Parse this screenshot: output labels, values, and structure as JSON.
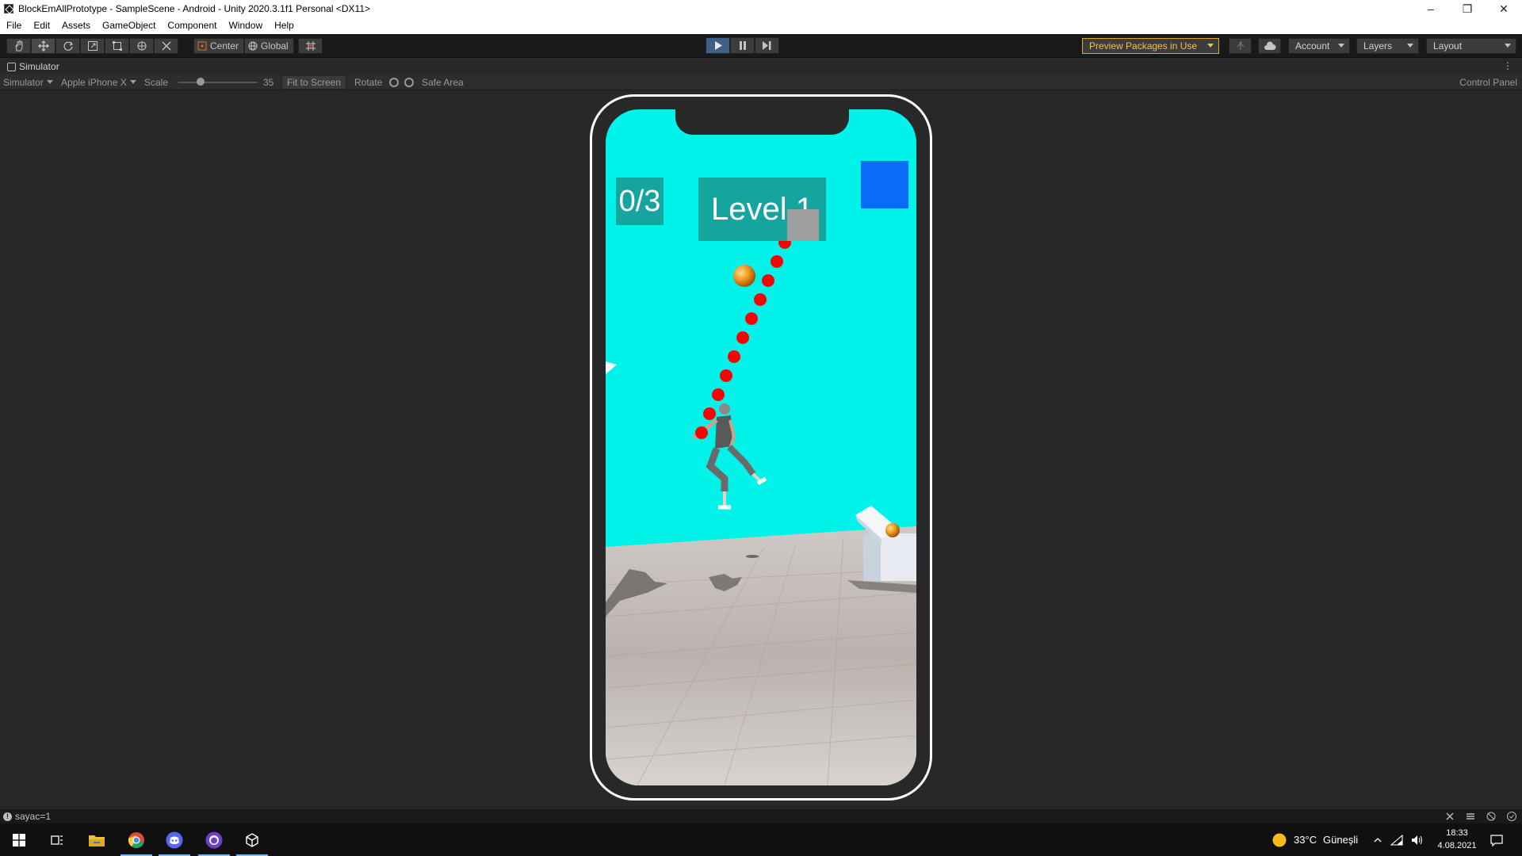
{
  "window": {
    "title": "BlockEmAllPrototype - SampleScene - Android - Unity 2020.3.1f1 Personal <DX11>",
    "minimize": "–",
    "restore": "❐",
    "close": "✕"
  },
  "menu": [
    "File",
    "Edit",
    "Assets",
    "GameObject",
    "Component",
    "Window",
    "Help"
  ],
  "toolbar": {
    "pivot": "Center",
    "space": "Global",
    "preview_packages": "Preview Packages in Use",
    "account": "Account",
    "layers": "Layers",
    "layout": "Layout"
  },
  "simulator": {
    "tab_title": "Simulator",
    "mode": "Simulator",
    "device": "Apple iPhone X",
    "scale_label": "Scale",
    "scale_value": "35",
    "fit_to_screen": "Fit to Screen",
    "rotate": "Rotate",
    "safe_area": "Safe Area",
    "control_panel": "Control Panel"
  },
  "game": {
    "score": "0/3",
    "level": "Level 1"
  },
  "status": {
    "message": "sayac=1"
  },
  "taskbar": {
    "weather_temp": "33°C",
    "weather_text": "Güneşli",
    "time": "18:33",
    "date": "4.08.2021"
  },
  "colors": {
    "sky": "#00f2e8",
    "hud_box": "#16a59e",
    "blue_square": "#0a6cf4",
    "trajectory_dot": "#ff0000",
    "play_active": "#3f5f86"
  }
}
